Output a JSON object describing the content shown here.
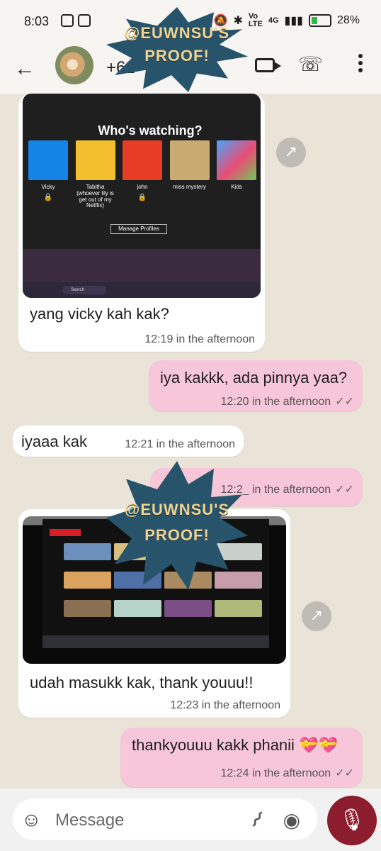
{
  "status_bar": {
    "time": "8:03",
    "signal_text": "4G",
    "battery": "28%"
  },
  "header": {
    "contact_name": "+62"
  },
  "watermark": {
    "line1": "@EUWNSU'S",
    "line2": "PROOF!"
  },
  "netflix_screen": {
    "title": "Who's watching?",
    "profiles": [
      {
        "name": "Vicky",
        "detail": ""
      },
      {
        "name": "Tabitha",
        "detail": "(whoever lily is get out of my Netflix)"
      },
      {
        "name": "john",
        "detail": ""
      },
      {
        "name": "miss mystery",
        "detail": ""
      },
      {
        "name": "Kids",
        "detail": ""
      }
    ],
    "manage_profiles": "Manage Profiles",
    "taskbar_search": "Search"
  },
  "messages": [
    {
      "text": "yang vicky kah kak?",
      "time": "12:19 in the afternoon"
    },
    {
      "text": "iya kakkk, ada pinnya yaa?",
      "time": "12:20 in the afternoon"
    },
    {
      "text": "iyaaa kak",
      "time": "12:21 in the afternoon"
    },
    {
      "text": "",
      "time": "12:2_ in the afternoon"
    },
    {
      "text": "udah masukk kak, thank youuu!!",
      "time": "12:23 in the afternoon"
    },
    {
      "text": "thankyouuu kakk phanii 💝💝",
      "time": "12:24 in the afternoon"
    }
  ],
  "input": {
    "placeholder": "Message"
  },
  "icons": [
    "back-icon",
    "video-icon",
    "phone-icon",
    "menu-icon",
    "share-icon",
    "emoji-icon",
    "attach-icon",
    "camera-icon",
    "mic-icon",
    "check-icon"
  ]
}
